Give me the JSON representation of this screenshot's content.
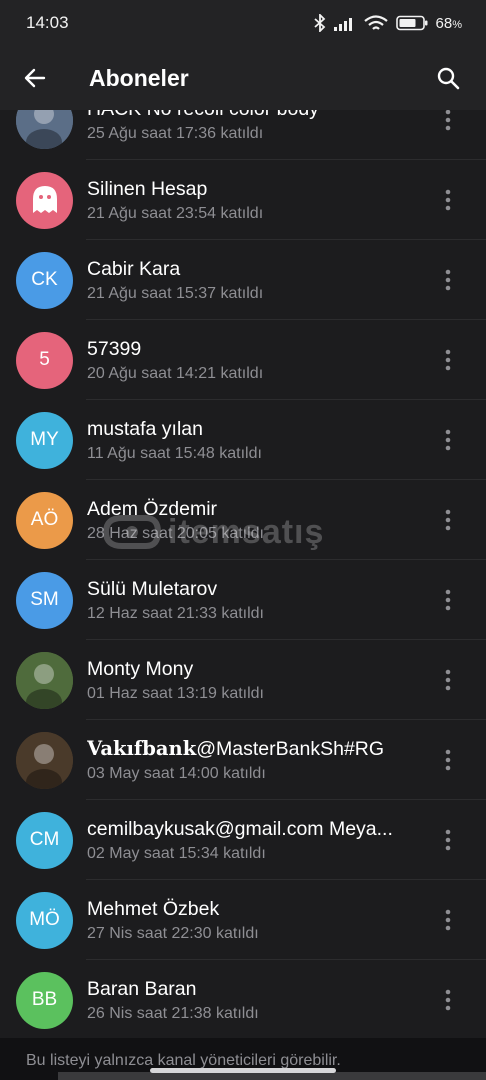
{
  "status_bar": {
    "time": "14:03",
    "battery_percent": "68",
    "battery_suffix": "%",
    "icons": [
      "bluetooth-icon",
      "signal-icon",
      "wifi-icon",
      "battery-icon"
    ]
  },
  "app_bar": {
    "title": "Aboneler",
    "back_icon": "arrow-left-icon",
    "search_icon": "search-icon"
  },
  "subscribers": [
    {
      "name": "HACK No recoil color body",
      "joined": "25 Ağu saat 17:36 katıldı",
      "avatar_type": "photo",
      "avatar_color": "#5b6e87"
    },
    {
      "name": "Silinen Hesap",
      "joined": "21 Ağu saat 23:54 katıldı",
      "avatar_type": "ghost",
      "avatar_color": "#e5647b"
    },
    {
      "name": "Cabir Kara",
      "joined": "21 Ağu saat 15:37 katıldı",
      "avatar_type": "initials",
      "initials": "CK",
      "avatar_color": "#4a9be6"
    },
    {
      "name": "57399",
      "joined": "20 Ağu saat 14:21 katıldı",
      "avatar_type": "initials",
      "initials": "5",
      "avatar_color": "#e5647b"
    },
    {
      "name": "mustafa yılan",
      "joined": "11 Ağu saat 15:48 katıldı",
      "avatar_type": "initials",
      "initials": "MY",
      "avatar_color": "#3fb2dc"
    },
    {
      "name": "Adem Özdemir",
      "joined": "28 Haz saat 20:05 katıldı",
      "avatar_type": "initials",
      "initials": "AÖ",
      "avatar_color": "#eb9a49"
    },
    {
      "name": "Sülü Muletarov",
      "joined": "12 Haz saat 21:33 katıldı",
      "avatar_type": "initials",
      "initials": "SM",
      "avatar_color": "#4a9be6"
    },
    {
      "name": "Monty Mony",
      "joined": "01 Haz saat 13:19 katıldı",
      "avatar_type": "photo",
      "avatar_color": "#4f6b3c"
    },
    {
      "name": "Vakıfbank@MasterBankSh#RG",
      "name_bold_part": "Vakıfbank",
      "name_rest": "@MasterBankSh#RG",
      "joined": "03 May saat 14:00 katıldı",
      "avatar_type": "photo",
      "avatar_color": "#4a3a2a"
    },
    {
      "name": "cemilbaykusak@gmail.com Meya...",
      "joined": "02 May saat 15:34 katıldı",
      "avatar_type": "initials",
      "initials": "CM",
      "avatar_color": "#3fb2dc"
    },
    {
      "name": "Mehmet Özbek",
      "joined": "27 Nis saat 22:30 katıldı",
      "avatar_type": "initials",
      "initials": "MÖ",
      "avatar_color": "#3fb2dc"
    },
    {
      "name": "Baran Baran",
      "joined": "26 Nis saat 21:38 katıldı",
      "avatar_type": "initials",
      "initials": "BB",
      "avatar_color": "#5bc15e"
    }
  ],
  "footer": {
    "text": "Bu listeyi yalnızca kanal yöneticileri görebilir."
  },
  "watermark": {
    "text": "itemsatış"
  },
  "colors": {
    "background": "#1c1c1e",
    "app_bar": "#232325",
    "secondary_text": "#8e8e93"
  }
}
